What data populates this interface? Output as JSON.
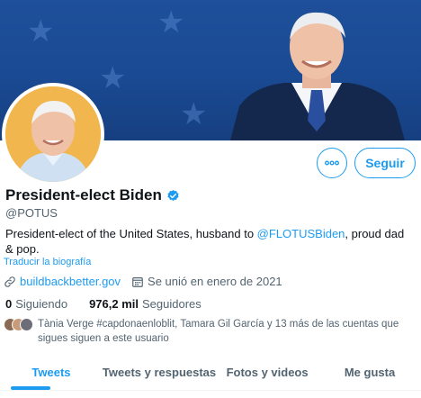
{
  "profile": {
    "name": "President-elect Biden",
    "handle": "@POTUS",
    "verified_icon": "verified-badge-icon",
    "bio_prefix": "President-elect of the United States, husband to ",
    "bio_mention": "@FLOTUSBiden",
    "bio_suffix": ", proud dad & pop.",
    "translate_link": "Traducir la biografía",
    "website": "buildbackbetter.gov",
    "joined": "Se unió en enero de 2021",
    "following_count": "0",
    "following_label": "Siguiendo",
    "followers_count": "976,2 mil",
    "followers_label": "Seguidores",
    "known_followers_text": "Tània Verge #capdonaenloblit, Tamara Gil García y 13 más de las cuentas que sigues siguen a este usuario"
  },
  "actions": {
    "more_icon": "more-options-icon",
    "follow_label": "Seguir"
  },
  "tabs": [
    {
      "label": "Tweets",
      "active": true
    },
    {
      "label": "Tweets y respuestas",
      "active": false
    },
    {
      "label": "Fotos y videos",
      "active": false
    },
    {
      "label": "Me gusta",
      "active": false
    }
  ],
  "colors": {
    "accent": "#1d9bf0",
    "banner": "#1a4a93",
    "text": "#0f1419",
    "secondary_text": "#536471"
  }
}
